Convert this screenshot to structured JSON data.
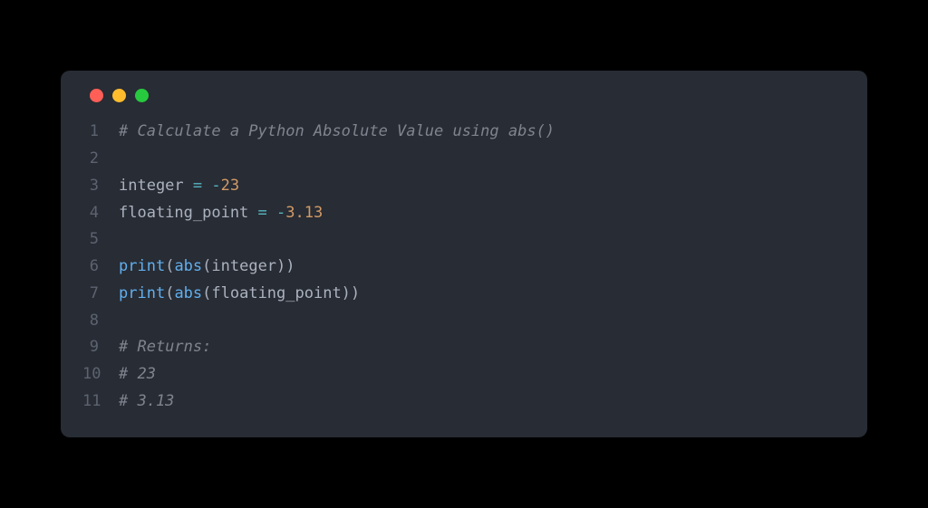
{
  "code": {
    "lines": [
      {
        "num": "1",
        "tokens": [
          {
            "cls": "tok-comment",
            "text": "# Calculate a Python Absolute Value using abs()"
          }
        ]
      },
      {
        "num": "2",
        "tokens": []
      },
      {
        "num": "3",
        "tokens": [
          {
            "cls": "tok-default",
            "text": "integer "
          },
          {
            "cls": "tok-operator",
            "text": "="
          },
          {
            "cls": "tok-default",
            "text": " "
          },
          {
            "cls": "tok-operator",
            "text": "-"
          },
          {
            "cls": "tok-number",
            "text": "23"
          }
        ]
      },
      {
        "num": "4",
        "tokens": [
          {
            "cls": "tok-default",
            "text": "floating_point "
          },
          {
            "cls": "tok-operator",
            "text": "="
          },
          {
            "cls": "tok-default",
            "text": " "
          },
          {
            "cls": "tok-operator",
            "text": "-"
          },
          {
            "cls": "tok-number",
            "text": "3.13"
          }
        ]
      },
      {
        "num": "5",
        "tokens": []
      },
      {
        "num": "6",
        "tokens": [
          {
            "cls": "tok-builtin",
            "text": "print"
          },
          {
            "cls": "tok-default",
            "text": "("
          },
          {
            "cls": "tok-builtin",
            "text": "abs"
          },
          {
            "cls": "tok-default",
            "text": "(integer))"
          }
        ]
      },
      {
        "num": "7",
        "tokens": [
          {
            "cls": "tok-builtin",
            "text": "print"
          },
          {
            "cls": "tok-default",
            "text": "("
          },
          {
            "cls": "tok-builtin",
            "text": "abs"
          },
          {
            "cls": "tok-default",
            "text": "(floating_point))"
          }
        ]
      },
      {
        "num": "8",
        "tokens": []
      },
      {
        "num": "9",
        "tokens": [
          {
            "cls": "tok-comment",
            "text": "# Returns:"
          }
        ]
      },
      {
        "num": "10",
        "tokens": [
          {
            "cls": "tok-comment",
            "text": "# 23"
          }
        ]
      },
      {
        "num": "11",
        "tokens": [
          {
            "cls": "tok-comment",
            "text": "# 3.13"
          }
        ]
      }
    ]
  }
}
